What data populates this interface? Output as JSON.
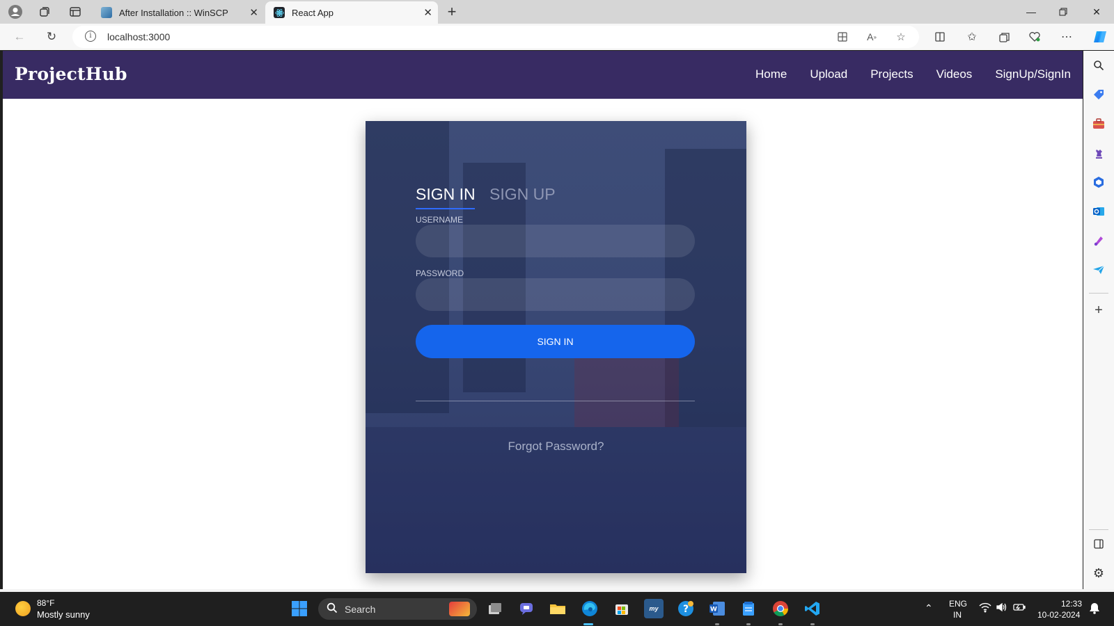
{
  "browser": {
    "tabs": [
      {
        "title": "After Installation :: WinSCP",
        "active": false
      },
      {
        "title": "React App",
        "active": true
      }
    ],
    "url": "localhost:3000"
  },
  "app": {
    "brand": "ProjectHub",
    "nav": [
      "Home",
      "Upload",
      "Projects",
      "Videos",
      "SignUp/SignIn"
    ]
  },
  "auth": {
    "tab_signin": "SIGN IN",
    "tab_signup": "SIGN UP",
    "username_label": "USERNAME",
    "username_value": "",
    "password_label": "PASSWORD",
    "password_value": "",
    "submit_label": "SIGN IN",
    "forgot_link": "Forgot Password?"
  },
  "taskbar": {
    "weather_temp": "88°F",
    "weather_desc": "Mostly sunny",
    "search_placeholder": "Search",
    "lang_line1": "ENG",
    "lang_line2": "IN",
    "time": "12:33",
    "date": "10-02-2024"
  },
  "colors": {
    "navbar": "#382b63",
    "primary_button": "#1565ec",
    "card_overlay": "#3e4d78"
  }
}
